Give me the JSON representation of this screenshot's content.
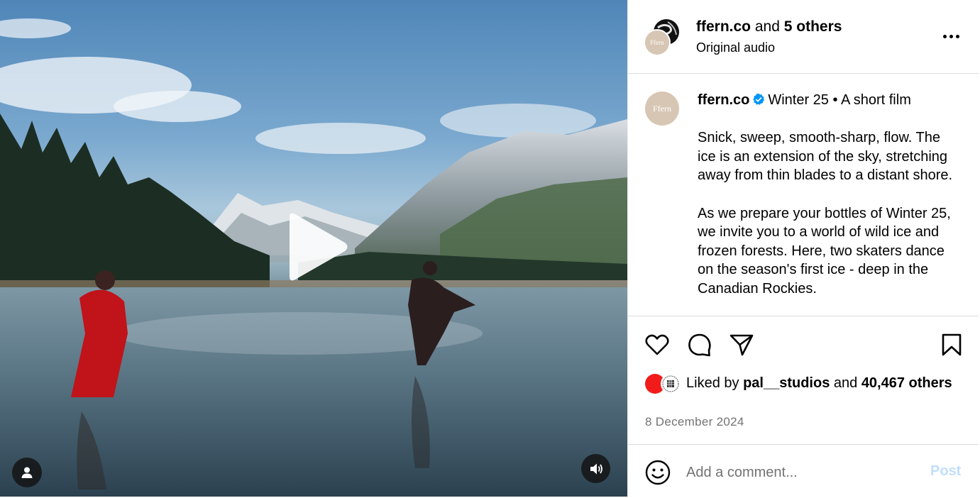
{
  "video": {
    "play_icon": "play-icon",
    "user_tag_icon": "user-icon",
    "mute_icon": "speaker-icon"
  },
  "header": {
    "account": "ffern.co",
    "connector": " and ",
    "others": "5 others",
    "audio": "Original audio",
    "avatar_label": "Ffern"
  },
  "caption": {
    "avatar_label": "Ffern",
    "username": "ffern.co",
    "title": "Winter 25 • A short film",
    "para1": "Snick, sweep, smooth-sharp, flow. The ice is an extension of the sky, stretching away from thin blades to a distant shore.",
    "para2": "As we prepare your bottles of Winter 25, we invite you to a world of wild ice and frozen forests. Here, two skaters dance on the season's first ice - deep in the Canadian Rockies."
  },
  "likes": {
    "prefix": "Liked by ",
    "user": "pal__studios",
    "middle": " and ",
    "count": "40,467 others"
  },
  "date": "8 December 2024",
  "comment": {
    "placeholder": "Add a comment...",
    "post_label": "Post"
  },
  "colors": {
    "verified": "#0095f6",
    "post_disabled": "#c0dffd",
    "ffern_avatar": "#d7c6b3"
  }
}
